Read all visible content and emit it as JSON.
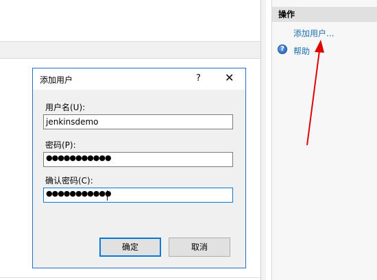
{
  "actions_pane": {
    "header": "操作",
    "add_user_link": "添加用户...",
    "help_link": "帮助",
    "help_icon_glyph": "?"
  },
  "dialog": {
    "title": "添加用户",
    "help_glyph": "?",
    "close_glyph": "✕",
    "username_label": "用户名(U):",
    "username_value": "jenkinsdemo",
    "password_label": "密码(P):",
    "password_value": "●●●●●●●●●●●",
    "confirm_label": "确认密码(C):",
    "confirm_value": "●●●●●●●●●●●",
    "ok_button": "确定",
    "cancel_button": "取消"
  },
  "annotation": {
    "arrow_color": "#e00000"
  }
}
